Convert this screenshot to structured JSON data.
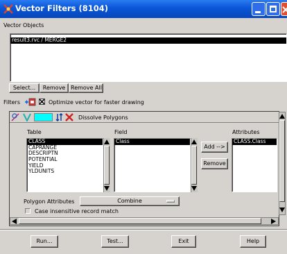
{
  "window": {
    "title": "Vector Filters (8104)",
    "accent": "#0a5fe0",
    "controls": [
      "minimize-icon",
      "maximize-icon",
      "close-icon"
    ]
  },
  "objects": {
    "label": "Vector Objects",
    "items": [
      "result3.rvc / MERGE2"
    ],
    "buttons": {
      "select": "Select...",
      "remove": "Remove",
      "remove_all": "Remove All"
    }
  },
  "filters": {
    "label": "Filters",
    "optimize_label": "Optimize vector for faster drawing",
    "optimize_checked": true
  },
  "dissolve": {
    "title": "Dissolve Polygons",
    "table_header": "Table",
    "field_header": "Field",
    "attributes_header": "Attributes",
    "tables": [
      "CLASS",
      "CAPRANGE",
      "DESCRIPTN",
      "POTENTIAL",
      "YIELD",
      "YLDUNITS"
    ],
    "selected_table": "CLASS",
    "fields": [
      "Class"
    ],
    "selected_field": "Class",
    "add_label": "Add -->",
    "remove_label": "Remove",
    "attributes": [
      "CLASS.Class"
    ],
    "polygon_attributes_label": "Polygon Attributes",
    "polygon_attributes_value": "Combine",
    "case_label": "Case insensitive record match",
    "case_checked": false
  },
  "footer": {
    "run": "Run...",
    "test": "Test...",
    "exit": "Exit",
    "help": "Help"
  }
}
